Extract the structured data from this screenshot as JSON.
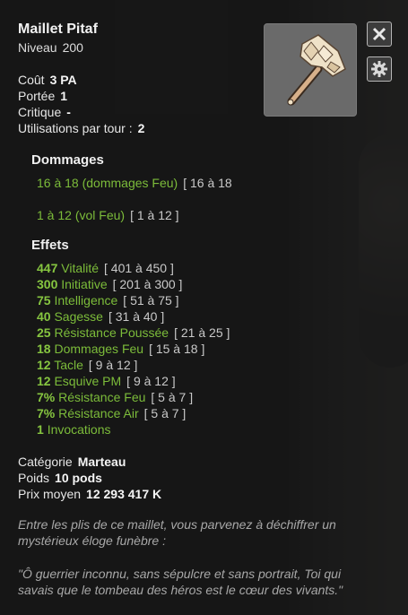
{
  "item": {
    "name": "Maillet Pitaf",
    "level_label": "Niveau",
    "level_value": "200"
  },
  "stats": [
    {
      "label": "Coût",
      "value": "3 PA"
    },
    {
      "label": "Portée",
      "value": "1"
    },
    {
      "label": "Critique",
      "value": "-"
    },
    {
      "label": "Utilisations par tour :",
      "value": "2"
    }
  ],
  "damage": {
    "title": "Dommages",
    "lines": [
      {
        "text": "16 à 18 (dommages Feu)",
        "range": "[ 16 à 18"
      },
      {
        "text": "1 à 12 (vol Feu)",
        "range": "[ 1 à 12 ]"
      }
    ]
  },
  "effects": {
    "title": "Effets",
    "lines": [
      {
        "value": "447",
        "name": "Vitalité",
        "range": "[ 401 à 450 ]"
      },
      {
        "value": "300",
        "name": "Initiative",
        "range": "[ 201 à 300 ]"
      },
      {
        "value": "75",
        "name": "Intelligence",
        "range": "[ 51 à 75 ]"
      },
      {
        "value": "40",
        "name": "Sagesse",
        "range": "[ 31 à 40 ]"
      },
      {
        "value": "25",
        "name": "Résistance Poussée",
        "range": "[ 21 à 25 ]"
      },
      {
        "value": "18",
        "name": "Dommages Feu",
        "range": "[ 15 à 18 ]"
      },
      {
        "value": "12",
        "name": "Tacle",
        "range": "[ 9 à 12 ]"
      },
      {
        "value": "12",
        "name": "Esquive PM",
        "range": "[ 9 à 12 ]"
      },
      {
        "value": "7%",
        "name": "Résistance Feu",
        "range": "[ 5 à 7 ]"
      },
      {
        "value": "7%",
        "name": "Résistance Air",
        "range": "[ 5 à 7 ]"
      },
      {
        "value": "1",
        "name": "Invocations",
        "range": ""
      }
    ]
  },
  "meta": [
    {
      "label": "Catégorie",
      "value": "Marteau"
    },
    {
      "label": "Poids",
      "value": "10 pods"
    },
    {
      "label": "Prix moyen",
      "value": "12 293 417 K"
    }
  ],
  "description": {
    "intro": "Entre les plis de ce maillet, vous parvenez à déchiffrer un mystérieux éloge funèbre :",
    "quote": "\"Ô guerrier inconnu, sans sépulcre et sans portrait, Toi qui savais que le tombeau des héros est le cœur des vivants.\""
  },
  "icons": {
    "close": "close-icon",
    "settings": "gear-icon",
    "item": "hammer-icon"
  },
  "colors": {
    "green": "#7cbc3a",
    "panel": "#1a1a1a",
    "frame": "#6a6a6a"
  }
}
